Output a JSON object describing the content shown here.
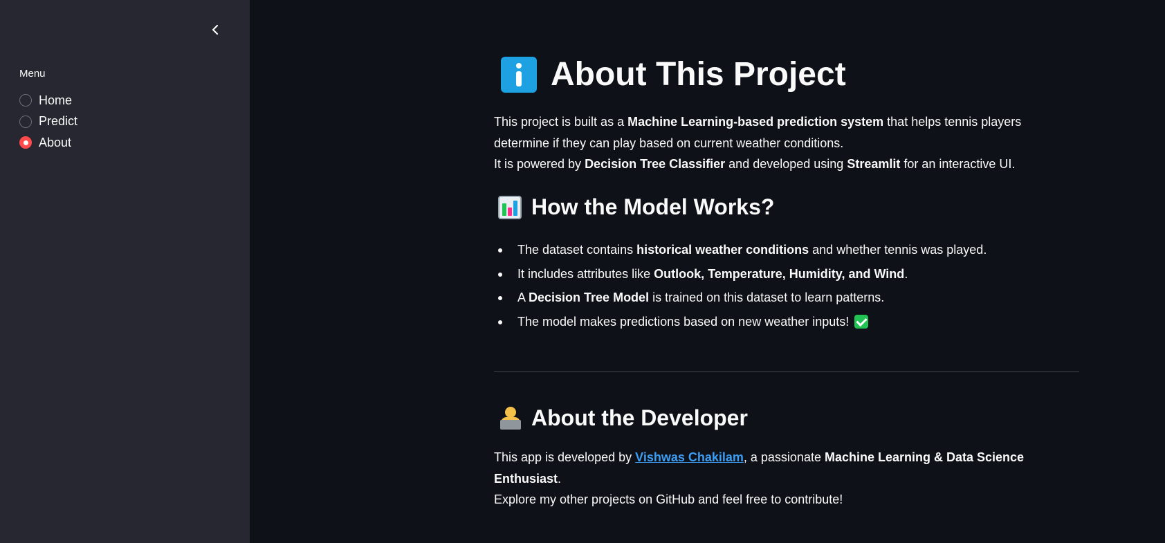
{
  "sidebar": {
    "menu_label": "Menu",
    "options": [
      {
        "label": "Home",
        "selected": false
      },
      {
        "label": "Predict",
        "selected": false
      },
      {
        "label": "About",
        "selected": true
      }
    ]
  },
  "main": {
    "title": "About This Project",
    "intro": {
      "p1_a": "This project is built as a ",
      "p1_b": "Machine Learning-based prediction system",
      "p1_c": " that helps tennis players determine if they can play based on current weather conditions.",
      "p2_a": "It is powered by ",
      "p2_b": "Decision Tree Classifier",
      "p2_c": " and developed using ",
      "p2_d": "Streamlit",
      "p2_e": " for an interactive UI."
    },
    "model_heading": "How the Model Works?",
    "bullets": {
      "b1_a": "The dataset contains ",
      "b1_b": "historical weather conditions",
      "b1_c": " and whether tennis was played.",
      "b2_a": "It includes attributes like ",
      "b2_b": "Outlook, Temperature, Humidity, and Wind",
      "b2_c": ".",
      "b3_a": "A ",
      "b3_b": "Decision Tree Model",
      "b3_c": " is trained on this dataset to learn patterns.",
      "b4_a": "The model makes predictions based on new weather inputs!"
    },
    "dev_heading": "About the Developer",
    "dev": {
      "a": "This app is developed by ",
      "link": "Vishwas Chakilam",
      "b": ", a passionate ",
      "c": "Machine Learning & Data Science Enthusiast",
      "d": ".",
      "e": "Explore my other projects on GitHub and feel free to contribute!"
    }
  },
  "icons": {
    "collapse": "chevron-left-icon",
    "title": "information-icon",
    "model": "bar-chart-icon",
    "developer": "technologist-icon",
    "check": "check-mark-button-icon"
  },
  "colors": {
    "sidebar_bg": "#262730",
    "main_bg": "#0e1117",
    "radio_selected": "#ff4b4b",
    "link": "#3d9df3",
    "check": "#21c354",
    "info": "#1da1e2"
  }
}
